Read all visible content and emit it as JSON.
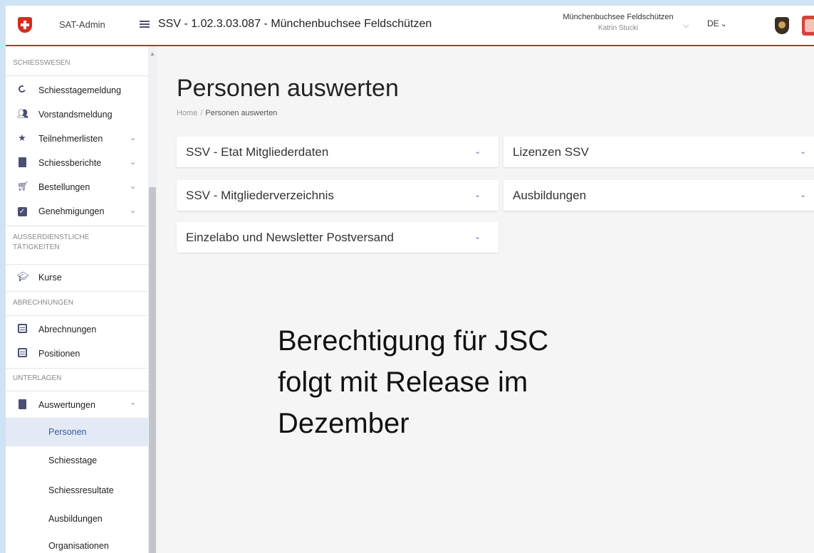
{
  "topbar": {
    "app_name": "SAT-Admin",
    "page_header": "SSV - 1.02.3.03.087 - Münchenbuchsee Feldschützen",
    "user_club": "Münchenbuchsee Feldschützen",
    "user_name": "Katrin Stucki",
    "language": "DE",
    "accent_color": "#c8302e"
  },
  "sidebar": {
    "sections": [
      {
        "heading": "SCHIESSWESEN"
      },
      {
        "heading": "AUSSERDIENSTLICHE TÄTIGKEITEN"
      },
      {
        "heading": "ABRECHNUNGEN"
      },
      {
        "heading": "UNTERLAGEN"
      }
    ],
    "items": [
      {
        "label": "Schiesstagemeldung",
        "icon": "circle-progress-icon"
      },
      {
        "label": "Vorstandsmeldung",
        "icon": "people-icon"
      },
      {
        "label": "Teilnehmerlisten",
        "icon": "star-icon"
      },
      {
        "label": "Schiessberichte",
        "icon": "document-icon"
      },
      {
        "label": "Bestellungen",
        "icon": "cart-icon"
      },
      {
        "label": "Genehmigungen",
        "icon": "checkbox-icon"
      },
      {
        "label": "Kurse",
        "icon": "graduation-cap-icon"
      },
      {
        "label": "Abrechnungen",
        "icon": "list-box-icon"
      },
      {
        "label": "Positionen",
        "icon": "list-box-icon"
      },
      {
        "label": "Auswertungen",
        "icon": "clipboard-icon"
      }
    ],
    "sub_items": [
      {
        "label": "Personen",
        "active": true
      },
      {
        "label": "Schiesstage"
      },
      {
        "label": "Schiessresultate"
      },
      {
        "label": "Ausbildungen"
      },
      {
        "label": "Organisationen"
      }
    ]
  },
  "main": {
    "title": "Personen auswerten",
    "breadcrumb": {
      "home": "Home",
      "separator": "/",
      "current": "Personen auswerten"
    },
    "cards": [
      {
        "label": "SSV - Etat Mitgliederdaten"
      },
      {
        "label": "Lizenzen SSV"
      },
      {
        "label": "SSV - Mitgliederverzeichnis"
      },
      {
        "label": "Ausbildungen"
      },
      {
        "label": "Einzelabo und Newsletter Postversand"
      }
    ],
    "overlay_note": "Berechtigung für JSC\nfolgt mit Release im\nDezember"
  }
}
